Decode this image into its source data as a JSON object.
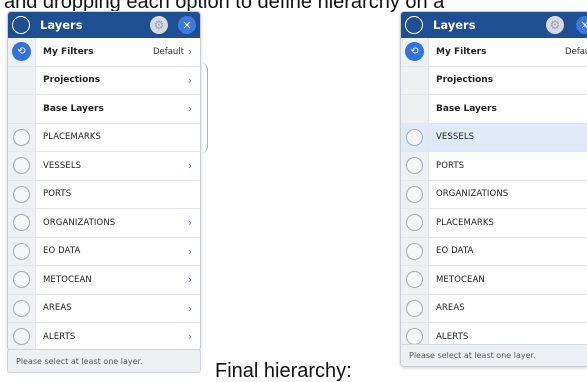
{
  "captions": {
    "top": "and dropping each option to define hierarchy on a",
    "bottom": "Final hierarchy:"
  },
  "left_panel": {
    "title": "Layers",
    "settings_icon": "gear-icon",
    "close_icon": "close-icon",
    "my_filters": {
      "label": "My Filters",
      "value": "Default"
    },
    "projections": {
      "label": "Projections"
    },
    "base_layers": {
      "label": "Base Layers"
    },
    "layers": [
      {
        "label": "PLACEMARKS",
        "has_chevron": false
      },
      {
        "label": "VESSELS",
        "has_chevron": true
      },
      {
        "label": "PORTS",
        "has_chevron": false
      },
      {
        "label": "ORGANIZATIONS",
        "has_chevron": true
      },
      {
        "label": "EO DATA",
        "has_chevron": true
      },
      {
        "label": "METOCEAN",
        "has_chevron": true
      },
      {
        "label": "AREAS",
        "has_chevron": true
      },
      {
        "label": "ALERTS",
        "has_chevron": true
      }
    ],
    "footer": "Please select at least one layer."
  },
  "right_panel": {
    "title": "Layers",
    "settings_icon": "gear-icon",
    "close_icon": "close-icon",
    "my_filters": {
      "label": "My Filters",
      "value": "Default"
    },
    "projections": {
      "label": "Projections"
    },
    "base_layers": {
      "label": "Base Layers"
    },
    "layers": [
      {
        "label": "VESSELS",
        "highlighted": true
      },
      {
        "label": "PORTS",
        "highlighted": false
      },
      {
        "label": "ORGANIZATIONS",
        "highlighted": false
      },
      {
        "label": "PLACEMARKS",
        "highlighted": false
      },
      {
        "label": "EO DATA",
        "highlighted": false
      },
      {
        "label": "METOCEAN",
        "highlighted": false
      },
      {
        "label": "AREAS",
        "highlighted": false
      },
      {
        "label": "ALERTS",
        "highlighted": false
      }
    ],
    "footer": "Please select at least one layer."
  },
  "colors": {
    "header": "#1f4f93",
    "accent": "#3c7ae0",
    "highlight_row": "#dfe9f7"
  }
}
